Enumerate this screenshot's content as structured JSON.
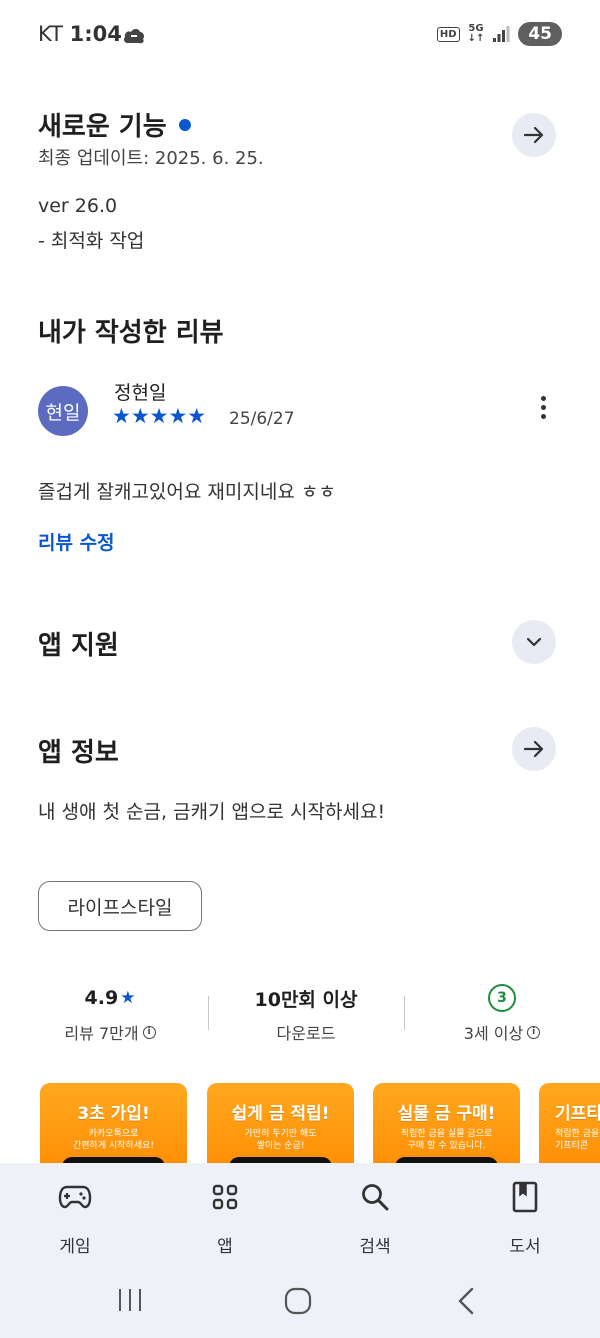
{
  "status_bar": {
    "carrier": "KT",
    "time": "1:04",
    "hd": "HD",
    "network": "5G",
    "battery": "45"
  },
  "whats_new": {
    "title": "새로운 기능",
    "updated": "최종 업데이트: 2025. 6. 25.",
    "version": "ver 26.0",
    "notes": "- 최적화 작업"
  },
  "my_review": {
    "title": "내가 작성한 리뷰",
    "avatar_text": "현일",
    "reviewer": "정현일",
    "stars": "★★★★★",
    "rating": 5,
    "date": "25/6/27",
    "text": "즐겁게 잘캐고있어요 재미지네요 ㅎㅎ",
    "edit_label": "리뷰 수정"
  },
  "app_support": {
    "title": "앱 지원"
  },
  "app_info": {
    "title": "앱 정보",
    "description": "내 생애 첫 순금, 금캐기 앱으로 시작하세요!",
    "category": "라이프스타일"
  },
  "stats": {
    "rating": "4.9",
    "rating_star": "★",
    "reviews": "리뷰 7만개",
    "downloads": "10만회 이상",
    "downloads_label": "다운로드",
    "age_badge": "3",
    "age_label": "3세 이상"
  },
  "screenshots": [
    {
      "title": "3초 가입!",
      "line1": "카카오톡으로",
      "line2": "간편하게 시작하세요!"
    },
    {
      "title": "쉽게 금 적립!",
      "line1": "가만히 두기만 해도",
      "line2": "쌓이는 순금!"
    },
    {
      "title": "실물 금 구매!",
      "line1": "적립한 금을 실물 금으로",
      "line2": "구매 할 수 있습니다."
    },
    {
      "title": "기프티",
      "line1": "적립한 금을",
      "line2": "기프티콘"
    }
  ],
  "bottom_nav": [
    {
      "label": "게임",
      "icon": "gamepad-icon"
    },
    {
      "label": "앱",
      "icon": "apps-grid-icon"
    },
    {
      "label": "검색",
      "icon": "search-icon"
    },
    {
      "label": "도서",
      "icon": "book-icon"
    }
  ],
  "colors": {
    "accent": "#0b57d0",
    "avatar": "#5c6bc0",
    "age_badge": "#1e8e3e",
    "nav_bg": "#eef1f8",
    "button_bg": "#e8ebf3",
    "screenshot_orange": "#ff9a10"
  }
}
